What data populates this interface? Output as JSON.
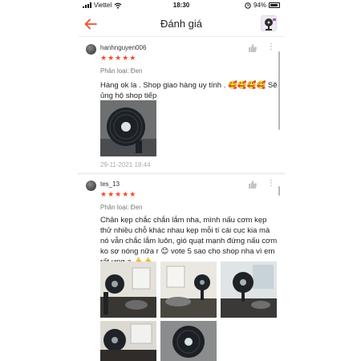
{
  "status_bar": {
    "carrier": "Viettel",
    "time": "18:30",
    "battery": "94%"
  },
  "header": {
    "title": "Đánh giá",
    "back_icon": "arrow-left-icon",
    "accent_color": "#ee4d2d"
  },
  "reviews": [
    {
      "username": "hanhnguyen006",
      "rating": 5,
      "stars": "★★★★★",
      "variant": "Phân loại: Đen",
      "text": "Hàng ok la . Shop giao hàng uy tính . 🥰🥰🥰🥰 Sẽ ủng hộ shop tiếp",
      "date": "29-11-2021 18:44",
      "photo_count": 1
    },
    {
      "username": "tes_13",
      "rating": 5,
      "stars": "★★★★★",
      "variant": "Phân loại: Đen",
      "text": "Chân kẹp chắc chắn lắm nha, mình nấu cơm kẹp thử nhiều chỗ khác nhau kẹp mỗi tí cái cục kia mà nó vẫn chắc lắm luôn, gió quạt mạnh đứng nấu cơm ko sợ nóng nữa r 😊 vote 5 sao cho shop nha vì em rất ưng ạ 👍👍",
      "photo_count": 5
    }
  ]
}
